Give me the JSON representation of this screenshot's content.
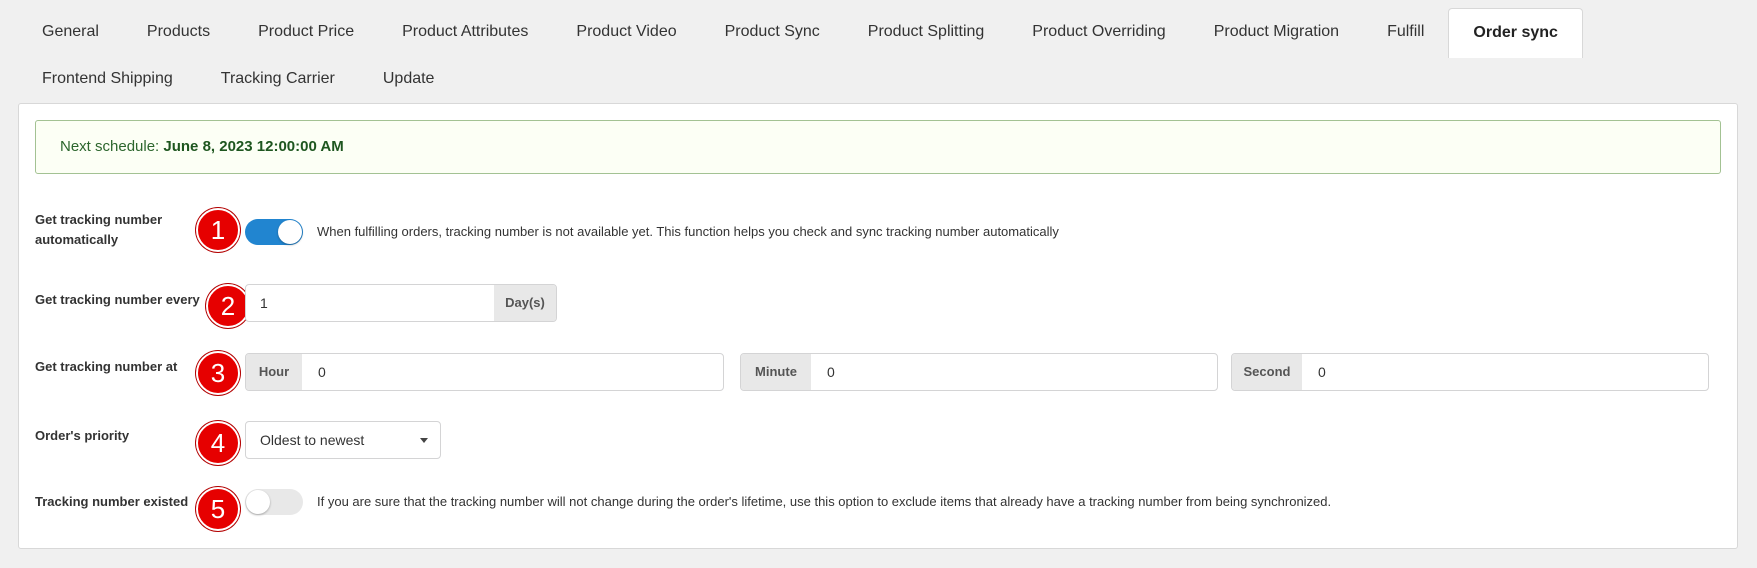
{
  "tabs": {
    "items": [
      {
        "label": "General"
      },
      {
        "label": "Products"
      },
      {
        "label": "Product Price"
      },
      {
        "label": "Product Attributes"
      },
      {
        "label": "Product Video"
      },
      {
        "label": "Product Sync"
      },
      {
        "label": "Product Splitting"
      },
      {
        "label": "Product Overriding"
      },
      {
        "label": "Product Migration"
      },
      {
        "label": "Fulfill"
      },
      {
        "label": "Order sync"
      },
      {
        "label": "Frontend Shipping"
      },
      {
        "label": "Tracking Carrier"
      },
      {
        "label": "Update"
      }
    ],
    "active": "Order sync"
  },
  "notice": {
    "prefix": "Next schedule: ",
    "datetime": "June 8, 2023 12:00:00 AM"
  },
  "settings": {
    "auto_tracking": {
      "label": "Get tracking number automatically",
      "badge": "1",
      "enabled": true,
      "description": "When fulfilling orders, tracking number is not available yet. This function helps you check and sync tracking number automatically"
    },
    "interval": {
      "label": "Get tracking number every",
      "badge": "2",
      "value": "1",
      "unit": "Day(s)"
    },
    "time_at": {
      "label": "Get tracking number at",
      "badge": "3",
      "hour_label": "Hour",
      "hour_value": "0",
      "minute_label": "Minute",
      "minute_value": "0",
      "second_label": "Second",
      "second_value": "0"
    },
    "priority": {
      "label": "Order's priority",
      "badge": "4",
      "selected": "Oldest to newest"
    },
    "tracking_existed": {
      "label": "Tracking number existed",
      "badge": "5",
      "enabled": false,
      "description": "If you are sure that the tracking number will not change during the order's lifetime, use this option to exclude items that already have a tracking number from being synchronized."
    }
  },
  "colors": {
    "accent": "#2185d0",
    "badge": "#e60000",
    "notice_bg": "#fcfff5",
    "notice_text": "#2c662d"
  }
}
